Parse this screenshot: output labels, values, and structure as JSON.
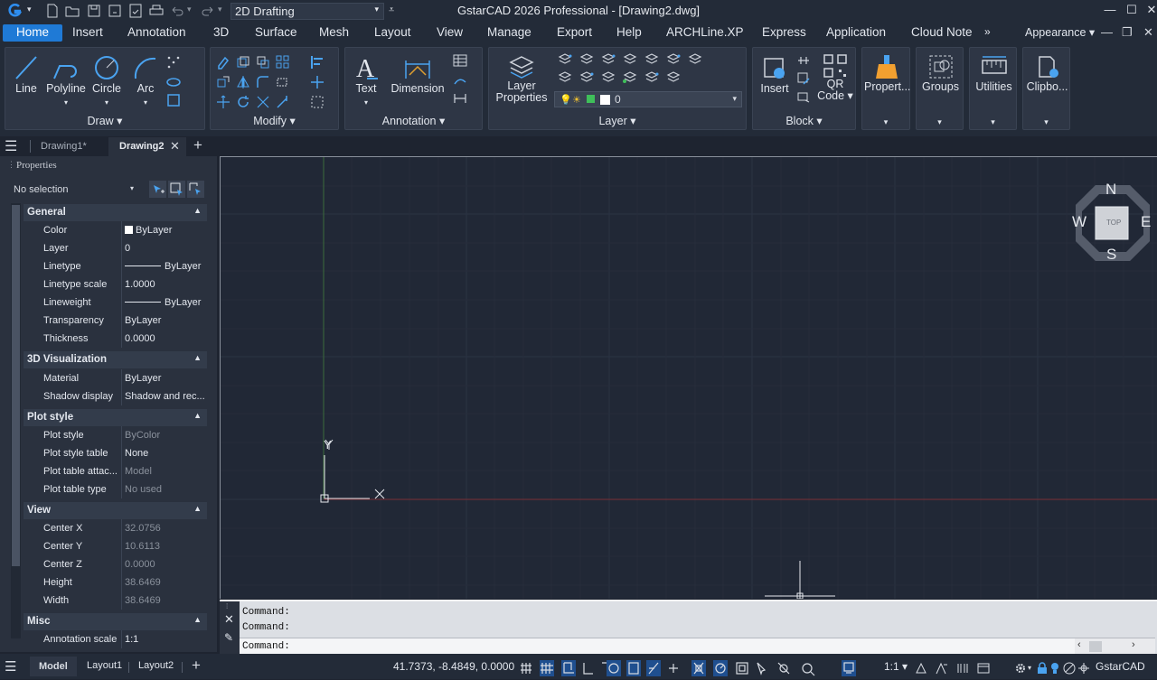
{
  "app": {
    "title": "GstarCAD 2026 Professional - [Drawing2.dwg]",
    "workspace": "2D Drafting",
    "brand_color": "#1f7ad6"
  },
  "window_controls": {
    "minimize": "—",
    "maximize": "☐",
    "close": "✕"
  },
  "menu": {
    "tabs": [
      "Home",
      "Insert",
      "Annotation",
      "3D",
      "Surface",
      "Mesh",
      "Layout",
      "View",
      "Manage",
      "Export",
      "Help",
      "ARCHLine.XP",
      "Express",
      "Application",
      "Cloud Note"
    ],
    "overflow": "»",
    "appearance": "Appearance"
  },
  "ribbon": {
    "draw": {
      "label": "Draw",
      "tools": [
        "Line",
        "Polyline",
        "Circle",
        "Arc"
      ]
    },
    "modify": {
      "label": "Modify"
    },
    "annotation": {
      "label": "Annotation",
      "tools": [
        "Text",
        "Dimension"
      ]
    },
    "layer": {
      "label": "Layer",
      "layer_properties": "Layer Properties",
      "current_layer": "0"
    },
    "block": {
      "label": "Block",
      "insert": "Insert",
      "qr_code": "QR Code"
    },
    "properties": "Propert...",
    "groups": "Groups",
    "utilities": "Utilities",
    "clipboard": "Clipbo..."
  },
  "doc_tabs": [
    {
      "label": "Drawing1*"
    },
    {
      "label": "Drawing2"
    }
  ],
  "properties": {
    "header": "Properties",
    "selection": "No selection",
    "sections": {
      "general": {
        "title": "General",
        "rows": [
          [
            "Color",
            "ByLayer"
          ],
          [
            "Layer",
            "0"
          ],
          [
            "Linetype",
            "ByLayer"
          ],
          [
            "Linetype scale",
            "1.0000"
          ],
          [
            "Lineweight",
            "ByLayer"
          ],
          [
            "Transparency",
            "ByLayer"
          ],
          [
            "Thickness",
            "0.0000"
          ]
        ]
      },
      "visualization": {
        "title": "3D Visualization",
        "rows": [
          [
            "Material",
            "ByLayer"
          ],
          [
            "Shadow display",
            "Shadow and rec..."
          ]
        ]
      },
      "plot": {
        "title": "Plot style",
        "rows": [
          [
            "Plot style",
            "ByColor"
          ],
          [
            "Plot style table",
            "None"
          ],
          [
            "Plot table attac...",
            "Model"
          ],
          [
            "Plot table type",
            "No used"
          ]
        ]
      },
      "view": {
        "title": "View",
        "rows": [
          [
            "Center X",
            "32.0756"
          ],
          [
            "Center Y",
            "10.6113"
          ],
          [
            "Center Z",
            "0.0000"
          ],
          [
            "Height",
            "38.6469"
          ],
          [
            "Width",
            "38.6469"
          ]
        ]
      },
      "misc": {
        "title": "Misc",
        "rows": [
          [
            "Annotation scale",
            "1:1"
          ]
        ]
      }
    }
  },
  "viewcube": {
    "n": "N",
    "s": "S",
    "e": "E",
    "w": "W",
    "face": "TOP"
  },
  "ucs": {
    "x": "X",
    "y": "Y"
  },
  "command": {
    "lines": [
      "Command:",
      "Command:"
    ],
    "prompt": "Command:"
  },
  "status": {
    "tabs": [
      "Model",
      "Layout1",
      "Layout2"
    ],
    "coords": "41.7373, -8.4849, 0.0000",
    "scale": "1:1",
    "brand": "GstarCAD"
  }
}
